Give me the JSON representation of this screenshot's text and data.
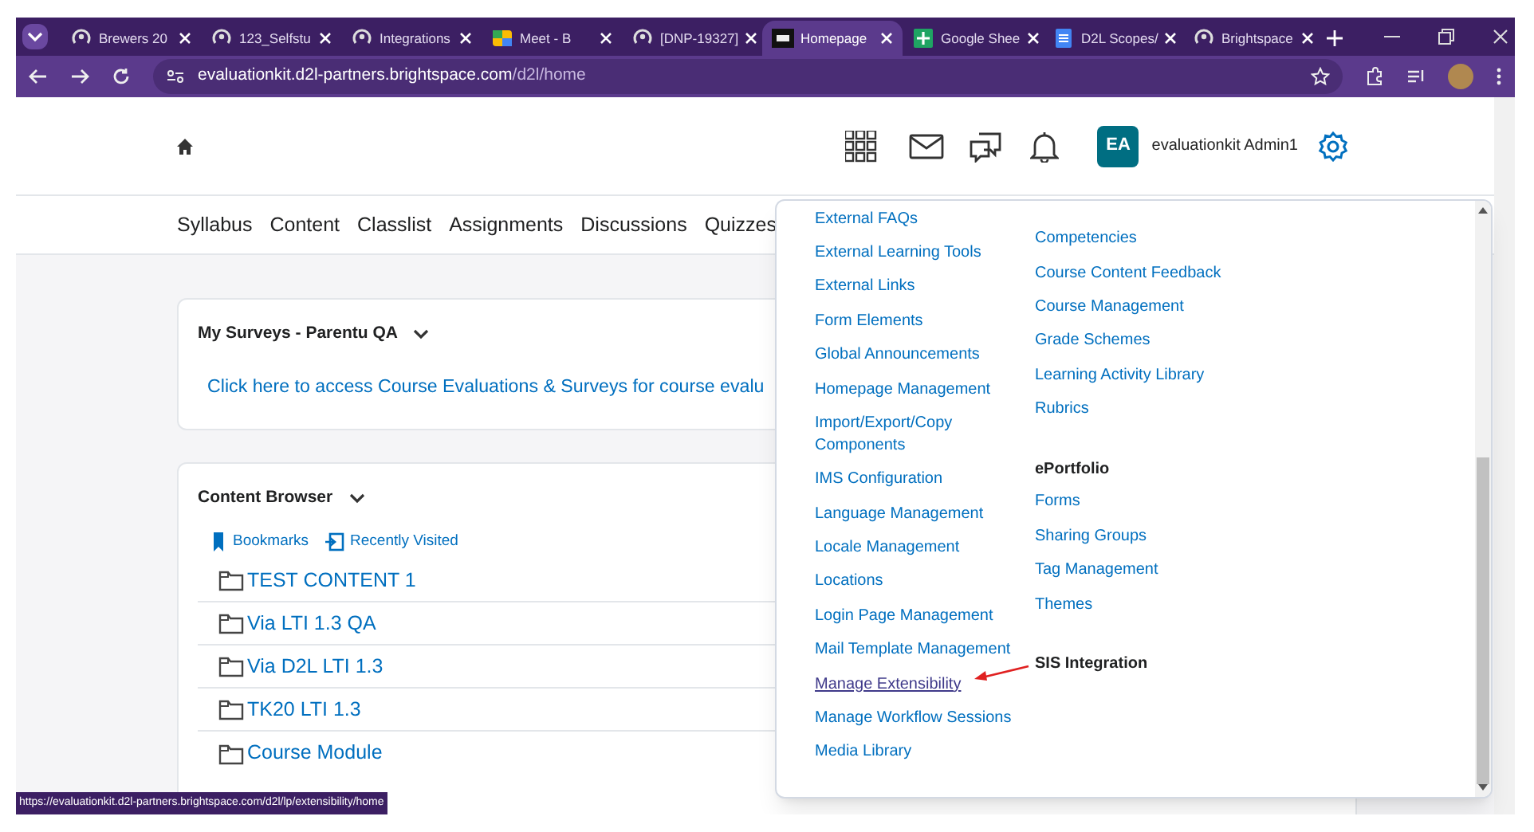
{
  "browser": {
    "tabs": [
      {
        "title": "Brewers 20",
        "kind": "swirl",
        "selected": false
      },
      {
        "title": "123_Selfstu",
        "kind": "swirl",
        "selected": false
      },
      {
        "title": "Integrations",
        "kind": "swirl",
        "selected": false
      },
      {
        "title": "Meet - B",
        "kind": "video",
        "selected": false
      },
      {
        "title": "[DNP-19327]",
        "kind": "swirl",
        "selected": false
      },
      {
        "title": "Homepage",
        "kind": "logo",
        "selected": true
      },
      {
        "title": "Google Shee",
        "kind": "sheet",
        "selected": false
      },
      {
        "title": "D2L Scopes/",
        "kind": "doc",
        "selected": false
      },
      {
        "title": "Brightspace",
        "kind": "swirl",
        "selected": false
      }
    ],
    "url_host": "evaluationkit.d2l-partners.brightspace.com",
    "url_path": "/d2l/home"
  },
  "header": {
    "avatar_initials": "EA",
    "user_name": "evaluationkit Admin1"
  },
  "nav": [
    "Syllabus",
    "Content",
    "Classlist",
    "Assignments",
    "Discussions",
    "Quizzes"
  ],
  "surveys_card": {
    "title": "My Surveys - Parentu QA",
    "link": "Click here to access Course Evaluations & Surveys for course evalu"
  },
  "content_card": {
    "title": "Content Browser",
    "bookmarks": "Bookmarks",
    "recent": "Recently Visited",
    "rows": [
      "TEST CONTENT 1",
      "Via LTI 1.3 QA",
      "Via D2L LTI 1.3",
      "TK20 LTI 1.3",
      "Course Module"
    ]
  },
  "admin_menu": {
    "left": [
      {
        "label": "External FAQs",
        "hovered": false
      },
      {
        "label": "External Learning Tools",
        "hovered": false
      },
      {
        "label": "External Links",
        "hovered": false
      },
      {
        "label": "Form Elements",
        "hovered": false
      },
      {
        "label": "Global Announcements",
        "hovered": false
      },
      {
        "label": "Homepage Management",
        "hovered": false
      },
      {
        "label": "Import/Export/Copy Components",
        "hovered": false
      },
      {
        "label": "IMS Configuration",
        "hovered": false
      },
      {
        "label": "Language Management",
        "hovered": false
      },
      {
        "label": "Locale Management",
        "hovered": false
      },
      {
        "label": "Locations",
        "hovered": false
      },
      {
        "label": "Login Page Management",
        "hovered": false
      },
      {
        "label": "Mail Template Management",
        "hovered": false
      },
      {
        "label": "Manage Extensibility",
        "hovered": true
      },
      {
        "label": "Manage Workflow Sessions",
        "hovered": false
      },
      {
        "label": "Media Library",
        "hovered": false
      }
    ],
    "right": [
      {
        "items": [
          "Competencies",
          "Course Content Feedback",
          "Course Management",
          "Grade Schemes",
          "Learning Activity Library",
          "Rubrics"
        ]
      },
      {
        "heading": "ePortfolio",
        "items": [
          "Forms",
          "Sharing Groups",
          "Tag Management",
          "Themes"
        ]
      },
      {
        "heading": "SIS Integration"
      }
    ]
  },
  "status_url": "https://evaluationkit.d2l-partners.brightspace.com/d2l/lp/extensibility/home"
}
